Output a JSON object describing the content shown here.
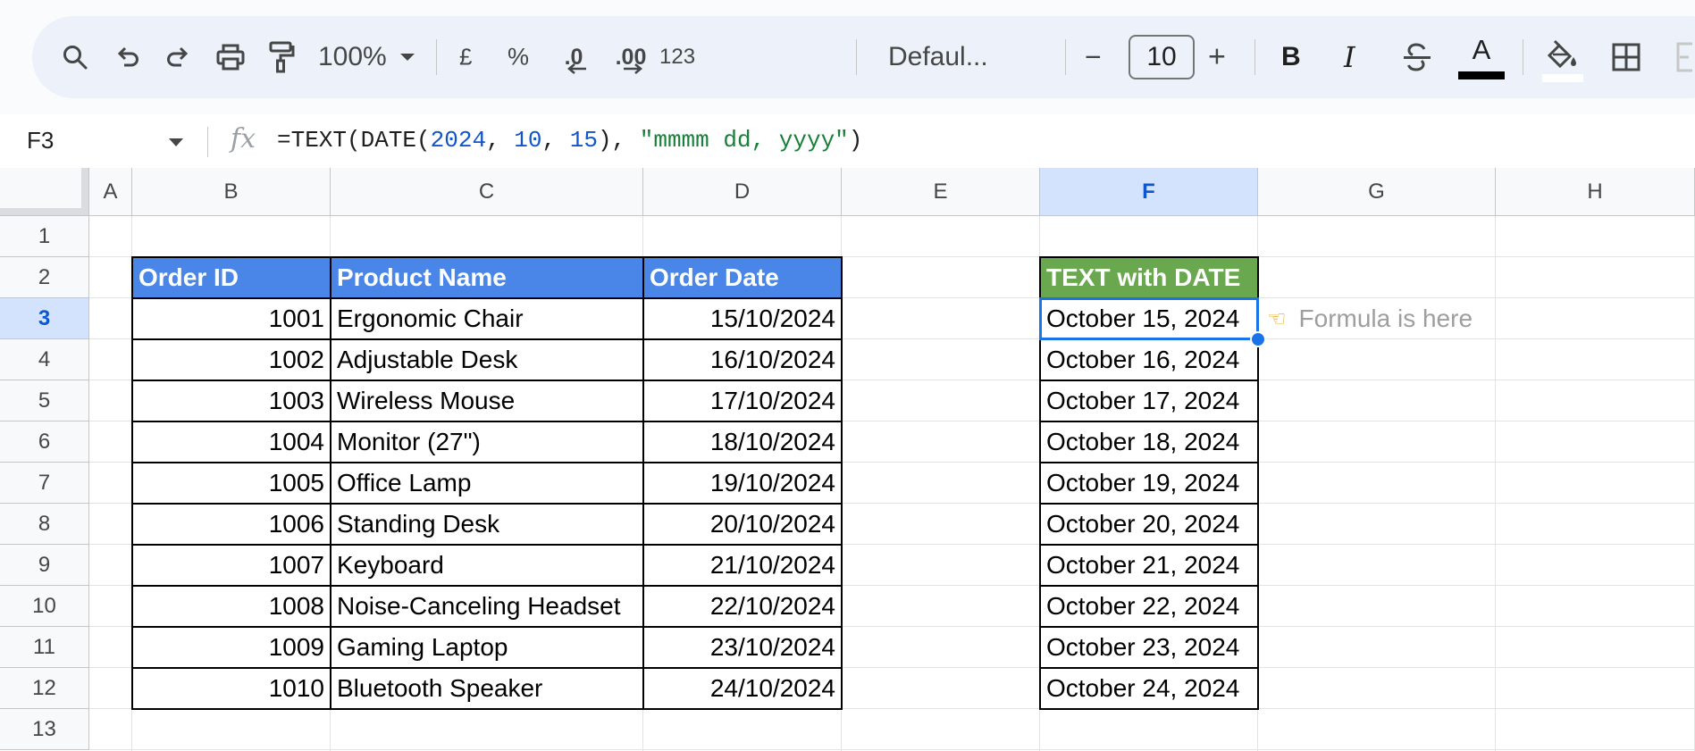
{
  "toolbar": {
    "zoom_label": "100%",
    "currency_label": "£",
    "percent_label": "%",
    "decrease_decimal_label": ".0",
    "increase_decimal_label": ".00",
    "more_formats_label": "123",
    "font_family_label": "Defaul...",
    "decrease_font_label": "−",
    "font_size_value": "10",
    "increase_font_label": "+",
    "bold_label": "B",
    "italic_label": "I",
    "text_color_label": "A",
    "text_color": "#000000"
  },
  "formula_bar": {
    "name_box": "F3",
    "fx_label": "fx",
    "formula_parts": {
      "p1": "=TEXT(DATE(",
      "n1": "2024",
      "s1": ", ",
      "n2": "10",
      "s2": ", ",
      "n3": "15",
      "s3": "), ",
      "str": "\"mmmm dd, yyyy\"",
      "close": ")"
    }
  },
  "sheet": {
    "columns": [
      "A",
      "B",
      "C",
      "D",
      "E",
      "F",
      "G",
      "H"
    ],
    "rows": [
      "1",
      "2",
      "3",
      "4",
      "5",
      "6",
      "7",
      "8",
      "9",
      "10",
      "11",
      "12",
      "13"
    ],
    "selected_cell": "F3",
    "headers": {
      "order_id": "Order ID",
      "product_name": "Product Name",
      "order_date": "Order Date",
      "text_with_date": "TEXT with DATE"
    },
    "header_colors": {
      "blue": "#4a86e8",
      "green": "#6aa84f"
    },
    "orders": [
      {
        "id": "1001",
        "product": "Ergonomic Chair",
        "date": "15/10/2024",
        "text_date": "October 15, 2024"
      },
      {
        "id": "1002",
        "product": "Adjustable Desk",
        "date": "16/10/2024",
        "text_date": "October 16, 2024"
      },
      {
        "id": "1003",
        "product": "Wireless Mouse",
        "date": "17/10/2024",
        "text_date": "October 17, 2024"
      },
      {
        "id": "1004",
        "product": "Monitor (27\")",
        "date": "18/10/2024",
        "text_date": "October 18, 2024"
      },
      {
        "id": "1005",
        "product": "Office Lamp",
        "date": "19/10/2024",
        "text_date": "October 19, 2024"
      },
      {
        "id": "1006",
        "product": "Standing Desk",
        "date": "20/10/2024",
        "text_date": "October 20, 2024"
      },
      {
        "id": "1007",
        "product": "Keyboard",
        "date": "21/10/2024",
        "text_date": "October 21, 2024"
      },
      {
        "id": "1008",
        "product": "Noise-Canceling Headset",
        "date": "22/10/2024",
        "text_date": "October 22, 2024"
      },
      {
        "id": "1009",
        "product": "Gaming Laptop",
        "date": "23/10/2024",
        "text_date": "October 23, 2024"
      },
      {
        "id": "1010",
        "product": "Bluetooth Speaker",
        "date": "24/10/2024",
        "text_date": "October 24, 2024"
      }
    ],
    "note": {
      "icon": "pointing-hand-icon",
      "text": "Formula is here"
    }
  }
}
